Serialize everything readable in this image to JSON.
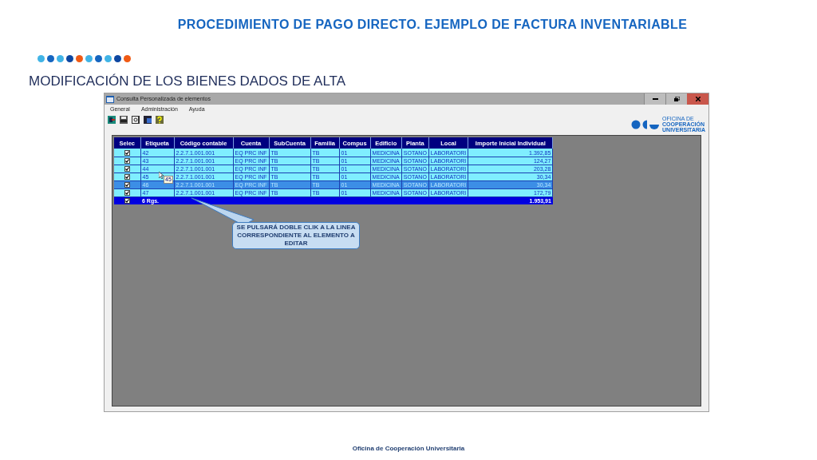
{
  "slide": {
    "title": "PROCEDIMIENTO DE PAGO DIRECTO. EJEMPLO DE FACTURA INVENTARIABLE",
    "dots": [
      {
        "color": "#41b4e6"
      },
      {
        "color": "#1565c0"
      },
      {
        "color": "#41b4e6"
      },
      {
        "color": "#0d47a1"
      },
      {
        "color": "#f05a14"
      },
      {
        "color": "#41b4e6"
      },
      {
        "color": "#1565c0"
      },
      {
        "color": "#41b4e6"
      },
      {
        "color": "#0d47a1"
      },
      {
        "color": "#f05a14"
      }
    ],
    "heading": "MODIFICACIÓN DE LOS BIENES DADOS DE ALTA",
    "footer": "Oficina de Cooperación Universitaria"
  },
  "window": {
    "title": "Consulta Personalizada de elementos",
    "menu": [
      "General",
      "Administración",
      "Ayuda"
    ],
    "logo": {
      "lines": [
        "OFICINA DE",
        "COOPERACIÓN",
        "UNIVERSITARIA"
      ]
    },
    "table": {
      "select_column": "Selec",
      "columns": [
        "Etiqueta",
        "Código contable",
        "Cuenta",
        "SubCuenta",
        "Familia",
        "Compus",
        "Edificio",
        "Planta",
        "Local",
        "Importe Inicial Individual"
      ],
      "rows": [
        {
          "checked": true,
          "selected": false,
          "cells": [
            "42",
            "2.2.7.1.001.001",
            "EQ PRC INF",
            "TB",
            "TB",
            "01",
            "MEDICINA",
            "SOTANO",
            "LABORATORI",
            "1.392,85"
          ]
        },
        {
          "checked": true,
          "selected": false,
          "cells": [
            "43",
            "2.2.7.1.001.001",
            "EQ PRC INF",
            "TB",
            "TB",
            "01",
            "MEDICINA",
            "SOTANO",
            "LABORATORI",
            "124,27"
          ]
        },
        {
          "checked": true,
          "selected": false,
          "cells": [
            "44",
            "2.2.7.1.001.001",
            "EQ PRC INF",
            "TB",
            "TB",
            "01",
            "MEDICINA",
            "SOTANO",
            "LABORATORI",
            "203,28"
          ]
        },
        {
          "checked": true,
          "selected": false,
          "cells": [
            "45",
            "2.2.7.1.001.001",
            "EQ PRC INF",
            "TB",
            "TB",
            "01",
            "MEDICINA",
            "SOTANO",
            "LABORATORI",
            "30,34"
          ]
        },
        {
          "checked": true,
          "selected": true,
          "cells": [
            "46",
            "2.2.7.1.001.001",
            "EQ PRC INF",
            "TB",
            "TB",
            "01",
            "MEDICINA",
            "SOTANO",
            "LABORATORI",
            "30,34"
          ]
        },
        {
          "checked": true,
          "selected": false,
          "cells": [
            "47",
            "2.2.7.1.001.001",
            "EQ PRC INF",
            "TB",
            "TB",
            "01",
            "MEDICINA",
            "SOTANO",
            "LABORATORI",
            "172,79"
          ]
        }
      ],
      "total": {
        "checked": true,
        "label": "6 Rgs.",
        "amount": "1.953,91"
      }
    },
    "drag_label": "45",
    "callout": "SE PULSARÁ DOBLE CLIK A LA LINEA CORRESPONDIENTE AL ELEMENTO A EDITAR"
  }
}
